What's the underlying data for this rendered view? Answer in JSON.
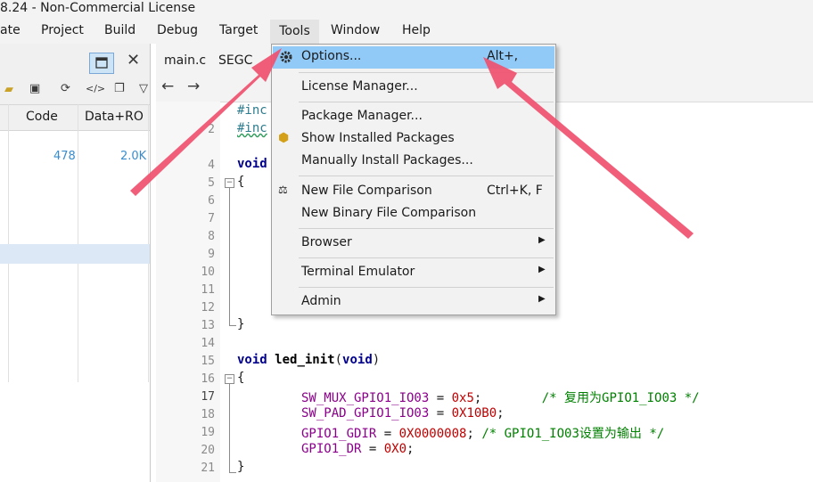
{
  "window": {
    "title": "8.24 - Non-Commercial License"
  },
  "menubar": [
    "ate",
    "Project",
    "Build",
    "Debug",
    "Target",
    "Tools",
    "Window",
    "Help"
  ],
  "left_panel": {
    "columns": [
      "Code",
      "Data+RO"
    ],
    "row": {
      "code": "478",
      "data_ro": "2.0K"
    }
  },
  "editor": {
    "tabs": [
      "main.c",
      "SEGC"
    ],
    "lines": [
      {
        "n": "",
        "text": "#inc"
      },
      {
        "n": "2",
        "text": "#inc"
      },
      {
        "n": "4",
        "text": "void"
      },
      {
        "n": "5",
        "text": "{"
      },
      {
        "n": "6",
        "text": ""
      },
      {
        "n": "7",
        "text": ""
      },
      {
        "n": "8",
        "text": ""
      },
      {
        "n": "9",
        "text": ""
      },
      {
        "n": "10",
        "text": ""
      },
      {
        "n": "11",
        "text": ""
      },
      {
        "n": "12",
        "text": ""
      },
      {
        "n": "13",
        "text": "}"
      },
      {
        "n": "14",
        "text": ""
      },
      {
        "n": "15",
        "text": "void led_init(void)"
      },
      {
        "n": "16",
        "text": "{"
      },
      {
        "n": "17",
        "text": "SW_MUX_GPIO1_IO03 = 0x5;        /* 复用为GPIO1_IO03 */"
      },
      {
        "n": "18",
        "text": "SW_PAD_GPIO1_IO03 = 0X10B0;"
      },
      {
        "n": "19",
        "text": "GPIO1_GDIR = 0X0000008; /* GPIO1_IO03设置为输出 */"
      },
      {
        "n": "20",
        "text": "GPIO1_DR = 0X0;"
      },
      {
        "n": "21",
        "text": "}"
      }
    ]
  },
  "tools_menu": {
    "items": [
      {
        "label": "Options...",
        "shortcut": "Alt+,",
        "icon": "gear-icon"
      },
      {
        "label": "License Manager...",
        "shortcut": ""
      },
      {
        "label": "Package Manager...",
        "shortcut": ""
      },
      {
        "label": "Show Installed Packages",
        "shortcut": "",
        "icon": "package-icon"
      },
      {
        "label": "Manually Install Packages...",
        "shortcut": ""
      },
      {
        "label": "New File Comparison",
        "shortcut": "Ctrl+K, F",
        "icon": "compare-icon"
      },
      {
        "label": "New Binary File Comparison",
        "shortcut": ""
      },
      {
        "label": "Browser",
        "shortcut": ""
      },
      {
        "label": "Terminal Emulator",
        "shortcut": ""
      },
      {
        "label": "Admin",
        "shortcut": ""
      }
    ]
  },
  "colors": {
    "highlight": "#91c9f7",
    "arrow": "#f0506e",
    "selected_row": "#dde8f6"
  }
}
